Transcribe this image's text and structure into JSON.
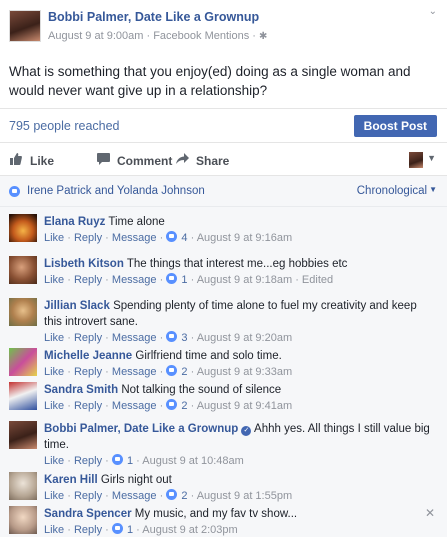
{
  "post": {
    "page_name": "Bobbi Palmer, Date Like a Grownup",
    "date": "August 9 at 9:00am",
    "separator": "·",
    "source": "Facebook Mentions",
    "gear_icon": "gear-icon",
    "text": "What is something that you enjoy(ed) doing as a single woman and would never want give up in a relationship?"
  },
  "reach": {
    "text": "795 people reached",
    "boost_label": "Boost Post"
  },
  "actions": {
    "like": "Like",
    "comment": "Comment",
    "share": "Share"
  },
  "likers": {
    "text": "Irene Patrick and Yolanda Johnson",
    "sort_label": "Chronological"
  },
  "comment_actions": {
    "like": "Like",
    "reply": "Reply",
    "message": "Message",
    "dot": "·"
  },
  "comments": [
    {
      "name": "Elana Ruyz",
      "text": "Time alone",
      "likes": "4",
      "time": "August 9 at 9:16am",
      "edited": ""
    },
    {
      "name": "Lisbeth Kitson",
      "text": "The things that interest me...eg hobbies etc",
      "likes": "1",
      "time": "August 9 at 9:18am",
      "edited": "Edited"
    },
    {
      "name": "Jillian Slack",
      "text": "Spending plenty of time alone to fuel my creativity and keep this introvert sane.",
      "likes": "3",
      "time": "August 9 at 9:20am",
      "edited": ""
    },
    {
      "name": "Michelle Jeanne",
      "text": "Girlfriend time and solo time.",
      "likes": "2",
      "time": "August 9 at 9:33am",
      "edited": ""
    },
    {
      "name": "Sandra Smith",
      "text": "Not talking the sound of silence",
      "likes": "2",
      "time": "August 9 at 9:41am",
      "edited": ""
    },
    {
      "name": "Bobbi Palmer, Date Like a Grownup",
      "text": "Ahhh yes. All things I still value big time.",
      "likes": "1",
      "time": "August 9 at 10:48am",
      "edited": "",
      "verified": true
    },
    {
      "name": "Karen Hill",
      "text": "Girls night out",
      "likes": "2",
      "time": "August 9 at 1:55pm",
      "edited": ""
    },
    {
      "name": "Sandra Spencer",
      "text": "My music, and my fav tv show...",
      "likes": "1",
      "time": "August 9 at 2:03pm",
      "edited": ""
    }
  ],
  "colors": {
    "link": "#365899",
    "boost": "#4267b2",
    "like_badge": "#5890ff",
    "panel_bg": "#f6f7f9"
  }
}
